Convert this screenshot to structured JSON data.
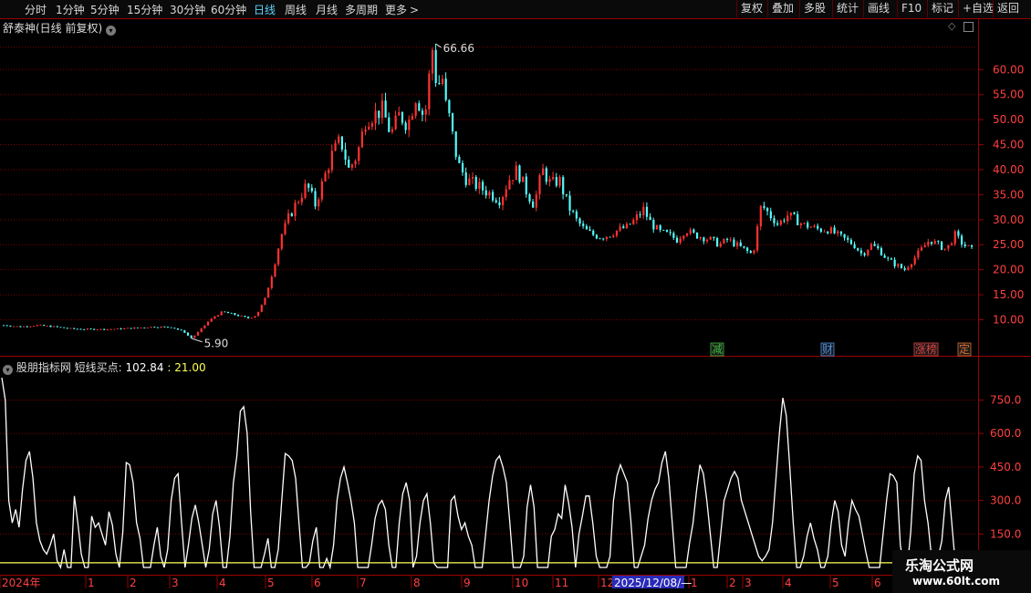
{
  "toolbar": {
    "periods": [
      {
        "label": "分时"
      },
      {
        "label": "1分钟"
      },
      {
        "label": "5分钟"
      },
      {
        "label": "15分钟"
      },
      {
        "label": "30分钟"
      },
      {
        "label": "60分钟"
      },
      {
        "label": "日线",
        "active": true
      },
      {
        "label": "周线"
      },
      {
        "label": "月线"
      },
      {
        "label": "多周期"
      },
      {
        "label": "更多"
      }
    ],
    "more_arrow": ">",
    "right_buttons": [
      "复权",
      "叠加",
      "多股",
      "统计",
      "画线",
      "F10",
      "标记",
      "+自选",
      "返回"
    ]
  },
  "price_panel": {
    "title": "舒泰神(日线 前复权)",
    "high_label": "66.66",
    "low_label": "5.90",
    "markers": [
      {
        "text": "减",
        "color": "#3fbf3f"
      },
      {
        "text": "财",
        "color": "#4a90e2"
      },
      {
        "text": "涨榜",
        "color": "#e04040"
      },
      {
        "text": "定",
        "color": "#e07030"
      }
    ]
  },
  "indicator_panel": {
    "title": "股朋指标网",
    "series_label": "短线买点:",
    "value1": "102.84",
    "value2": "21.00"
  },
  "x_axis": {
    "labels": [
      "2024年",
      "1",
      "2",
      "3",
      "4",
      "5",
      "6",
      "7",
      "8",
      "9",
      "10",
      "11",
      "12",
      "1",
      "2",
      "3",
      "4",
      "5",
      "6"
    ],
    "cursor_date": "2025/12/08/—"
  },
  "watermark": {
    "name": "乐淘公式网",
    "url": "www.60lt.com"
  },
  "colors": {
    "up": "#ff3232",
    "down": "#54fcfc",
    "flat": "#cfcfcf",
    "grid": "#7a0000",
    "border": "#9a0000",
    "axis_text": "#ff4040",
    "indicator_line": "#ffffff",
    "baseline": "#ffff55"
  },
  "chart_data": [
    {
      "type": "candlestick",
      "title": "舒泰神(日线 前复权)",
      "ylim": [
        6,
        66
      ],
      "yticks": [
        10,
        15,
        20,
        25,
        30,
        35,
        40,
        45,
        50,
        55,
        60
      ],
      "grid": true,
      "annotations": [
        {
          "text": "66.66",
          "kind": "high"
        },
        {
          "text": "5.90",
          "kind": "low"
        }
      ],
      "series": [
        {
          "values": [
            [
              0,
              8.9
            ],
            [
              0.02,
              8.6
            ],
            [
              0.04,
              8.9
            ],
            [
              0.06,
              8.6
            ],
            [
              0.08,
              8.2
            ],
            [
              0.1,
              8.1
            ],
            [
              0.12,
              8.1
            ],
            [
              0.14,
              8.2
            ],
            [
              0.16,
              8.4
            ],
            [
              0.18,
              8.6
            ],
            [
              0.2,
              8.5
            ],
            [
              0.215,
              7.5
            ],
            [
              0.222,
              6.3
            ],
            [
              0.228,
              7.0
            ],
            [
              0.235,
              8.2
            ],
            [
              0.242,
              9.5
            ],
            [
              0.25,
              10.6
            ],
            [
              0.26,
              11.6
            ],
            [
              0.275,
              11.0
            ],
            [
              0.29,
              10.3
            ],
            [
              0.3,
              10.9
            ],
            [
              0.31,
              14
            ],
            [
              0.32,
              20
            ],
            [
              0.33,
              27
            ],
            [
              0.34,
              31
            ],
            [
              0.35,
              34
            ],
            [
              0.36,
              37
            ],
            [
              0.37,
              33
            ],
            [
              0.38,
              38
            ],
            [
              0.39,
              43
            ],
            [
              0.4,
              46
            ],
            [
              0.41,
              40
            ],
            [
              0.42,
              43
            ],
            [
              0.43,
              50
            ],
            [
              0.44,
              51
            ],
            [
              0.45,
              52
            ],
            [
              0.46,
              47
            ],
            [
              0.47,
              51
            ],
            [
              0.48,
              49
            ],
            [
              0.49,
              55
            ],
            [
              0.5,
              50
            ],
            [
              0.505,
              58
            ],
            [
              0.51,
              65
            ],
            [
              0.515,
              55
            ],
            [
              0.52,
              60
            ],
            [
              0.525,
              53
            ],
            [
              0.53,
              50
            ],
            [
              0.535,
              45
            ],
            [
              0.54,
              41
            ],
            [
              0.55,
              38
            ],
            [
              0.56,
              37
            ],
            [
              0.57,
              36
            ],
            [
              0.58,
              35
            ],
            [
              0.59,
              34
            ],
            [
              0.6,
              38
            ],
            [
              0.61,
              40
            ],
            [
              0.62,
              36
            ],
            [
              0.63,
              33
            ],
            [
              0.64,
              40
            ],
            [
              0.65,
              37
            ],
            [
              0.66,
              38
            ],
            [
              0.67,
              33
            ],
            [
              0.68,
              30
            ],
            [
              0.69,
              28
            ],
            [
              0.7,
              27
            ],
            [
              0.71,
              26.5
            ],
            [
              0.72,
              27
            ],
            [
              0.73,
              28
            ],
            [
              0.74,
              28.5
            ],
            [
              0.75,
              30
            ],
            [
              0.76,
              32
            ],
            [
              0.77,
              29
            ],
            [
              0.78,
              27.5
            ],
            [
              0.79,
              27
            ],
            [
              0.8,
              26
            ],
            [
              0.81,
              28
            ],
            [
              0.82,
              27
            ],
            [
              0.83,
              26.5
            ],
            [
              0.84,
              26
            ],
            [
              0.85,
              25
            ],
            [
              0.86,
              26
            ],
            [
              0.87,
              25
            ],
            [
              0.88,
              24
            ],
            [
              0.89,
              23
            ],
            [
              0.9,
              33
            ],
            [
              0.91,
              31
            ],
            [
              0.92,
              29
            ],
            [
              0.93,
              31
            ],
            [
              0.94,
              30
            ],
            [
              0.95,
              29
            ],
            [
              0.96,
              28.5
            ],
            [
              0.97,
              28
            ],
            [
              0.98,
              28
            ],
            [
              0.99,
              27
            ],
            [
              1.0,
              26
            ],
            [
              1.01,
              25
            ],
            [
              1.02,
              23
            ],
            [
              1.03,
              25
            ],
            [
              1.04,
              24
            ],
            [
              1.05,
              22
            ],
            [
              1.06,
              21
            ],
            [
              1.07,
              20
            ],
            [
              1.08,
              22
            ],
            [
              1.09,
              24
            ],
            [
              1.1,
              26
            ],
            [
              1.11,
              25
            ],
            [
              1.12,
              24
            ],
            [
              1.13,
              27
            ],
            [
              1.14,
              25
            ],
            [
              1.15,
              24
            ]
          ]
        }
      ]
    },
    {
      "type": "line",
      "title": "股朋指标网",
      "ylim": [
        0,
        900
      ],
      "yticks": [
        150,
        300,
        450,
        600,
        750
      ],
      "series": [
        {
          "name": "短线买点",
          "values": [
            850,
            750,
            300,
            200,
            260,
            180,
            350,
            480,
            520,
            400,
            200,
            120,
            80,
            60,
            100,
            150,
            30,
            0,
            80,
            0,
            0,
            320,
            200,
            60,
            0,
            0,
            230,
            180,
            200,
            150,
            100,
            250,
            190,
            60,
            0,
            160,
            470,
            460,
            380,
            200,
            130,
            0,
            0,
            0,
            100,
            180,
            50,
            0,
            80,
            300,
            400,
            420,
            200,
            0,
            100,
            220,
            280,
            200,
            100,
            0,
            80,
            240,
            300,
            180,
            0,
            0,
            140,
            380,
            500,
            700,
            720,
            600,
            250,
            0,
            0,
            0,
            60,
            130,
            0,
            0,
            80,
            300,
            510,
            500,
            480,
            400,
            200,
            0,
            0,
            20,
            120,
            180,
            0,
            0,
            40,
            0,
            100,
            300,
            400,
            450,
            380,
            300,
            200,
            0,
            0,
            0,
            0,
            100,
            220,
            280,
            300,
            260,
            100,
            0,
            0,
            200,
            330,
            380,
            300,
            0,
            50,
            200,
            300,
            330,
            200,
            20,
            0,
            0,
            0,
            0,
            300,
            320,
            230,
            170,
            200,
            140,
            100,
            0,
            0,
            0,
            150,
            300,
            410,
            480,
            500,
            450,
            380,
            200,
            0,
            0,
            0,
            50,
            270,
            370,
            270,
            0,
            0,
            0,
            0,
            140,
            170,
            240,
            220,
            370,
            290,
            180,
            0,
            150,
            230,
            320,
            320,
            200,
            50,
            0,
            0,
            0,
            50,
            300,
            410,
            460,
            420,
            380,
            210,
            0,
            0,
            50,
            100,
            220,
            300,
            350,
            380,
            470,
            520,
            400,
            200,
            0,
            0,
            0,
            0,
            110,
            200,
            340,
            460,
            420,
            300,
            150,
            0,
            0,
            150,
            300,
            350,
            400,
            430,
            400,
            300,
            250,
            200,
            150,
            100,
            50,
            30,
            50,
            80,
            200,
            400,
            600,
            760,
            680,
            450,
            200,
            0,
            0,
            50,
            140,
            200,
            130,
            80,
            0,
            0,
            50,
            200,
            300,
            250,
            100,
            50,
            200,
            300,
            260,
            230,
            150,
            70,
            0,
            0,
            0,
            0,
            150,
            300,
            420,
            410,
            380,
            100,
            0,
            0,
            160,
            420,
            500,
            480,
            300,
            200,
            50,
            0,
            50,
            120,
            300,
            360,
            180,
            0,
            0,
            0
          ]
        },
        {
          "name": "baseline",
          "values": [
            21,
            21
          ]
        }
      ]
    }
  ]
}
